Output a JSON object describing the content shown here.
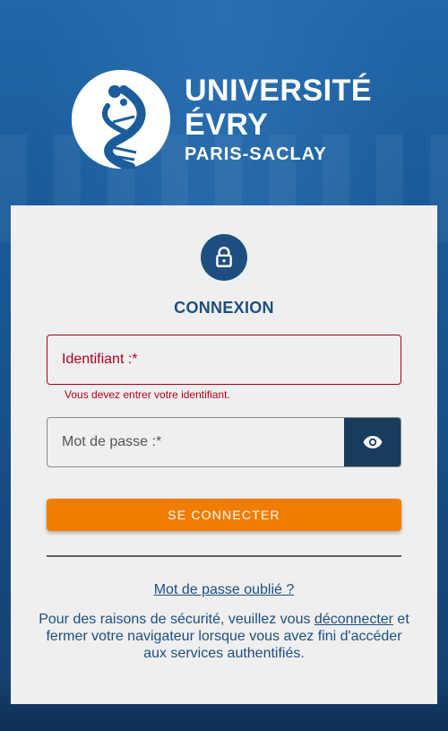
{
  "brand": {
    "title": "UNIVERSITÉ ÉVRY",
    "subtitle": "PARIS-SACLAY",
    "logo_icon": "dna-helix-logo-icon"
  },
  "login": {
    "lock_icon": "lock-icon",
    "heading": "CONNEXION",
    "username": {
      "label": "Identifiant :*",
      "value": "",
      "error": "Vous devez entrer votre identifiant."
    },
    "password": {
      "label": "Mot de passe :*",
      "value": "",
      "toggle_icon": "eye-icon"
    },
    "submit_label": "SE CONNECTER",
    "forgot_label": "Mot de passe oublié ?",
    "notice": {
      "before": "Pour des raisons de sécurité, veuillez vous ",
      "link": "déconnecter",
      "after": " et fermer votre navigateur lorsque vous avez fini d'accéder aux services authentifiés."
    }
  },
  "colors": {
    "accent": "#f07d00",
    "primary": "#1c4f80",
    "error": "#b00020",
    "eye_button": "#173c5c"
  }
}
